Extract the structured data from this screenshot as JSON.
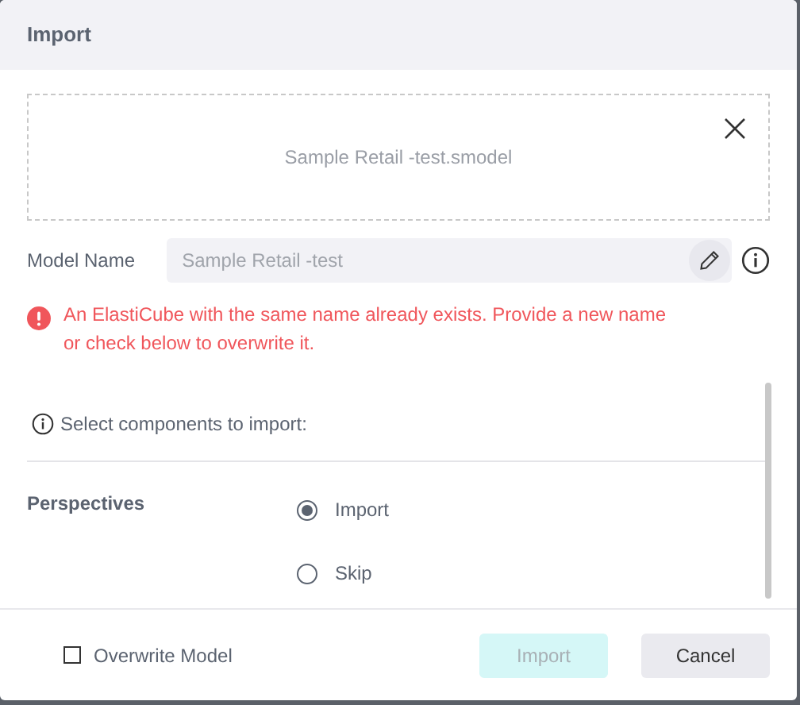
{
  "dialog": {
    "title": "Import"
  },
  "file": {
    "name": "Sample Retail -test.smodel"
  },
  "model_name": {
    "label": "Model Name",
    "placeholder": "Sample Retail -test"
  },
  "error": {
    "message": "An ElastiCube with the same name already exists. Provide a new name or check below to overwrite it."
  },
  "components": {
    "hint": "Select components to import:",
    "sections": [
      {
        "label": "Perspectives",
        "options": [
          {
            "label": "Import",
            "selected": true
          },
          {
            "label": "Skip",
            "selected": false
          }
        ]
      }
    ]
  },
  "footer": {
    "overwrite": {
      "label": "Overwrite Model",
      "checked": false
    },
    "buttons": [
      {
        "label": "Import",
        "kind": "primary",
        "disabled": true
      },
      {
        "label": "Cancel",
        "kind": "secondary",
        "disabled": false
      }
    ]
  }
}
